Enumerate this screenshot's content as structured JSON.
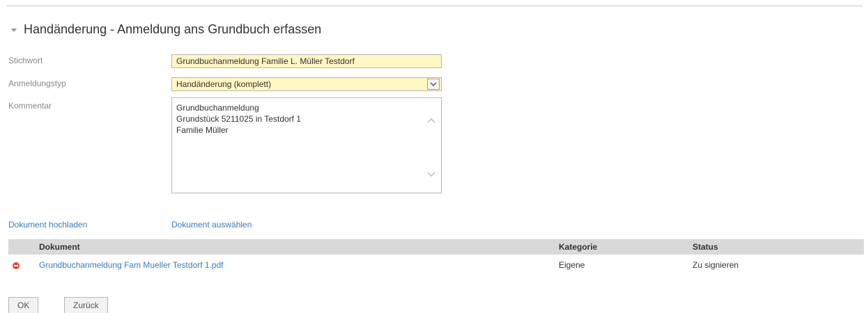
{
  "section": {
    "title": "Handänderung - Anmeldung ans Grundbuch erfassen",
    "toggle_icon": "collapse-triangle-icon"
  },
  "form": {
    "stichwort": {
      "label": "Stichwort",
      "value": "Grundbuchanmeldung Familie L. Müller Testdorf"
    },
    "anmeldungstyp": {
      "label": "Anmeldungstyp",
      "value": "Handänderung (komplett)"
    },
    "kommentar": {
      "label": "Kommentar",
      "value": "Grundbuchanmeldung\nGrundstück 5211025 in Testdorf 1\nFamilie Müller"
    }
  },
  "upload": {
    "hochladen_label": "Dokument hochladen",
    "auswaehlen_label": "Dokument auswählen"
  },
  "documents": {
    "columns": [
      "Dokument",
      "Kategorie",
      "Status"
    ],
    "rows": [
      {
        "name": "Grundbuchanmeldung Fam Mueller Testdorf 1.pdf",
        "kategorie": "Eigene",
        "status": "Zu signieren"
      }
    ]
  },
  "buttons": {
    "ok": "OK",
    "zurueck": "Zurück"
  },
  "colors": {
    "input_background": "#fff7c2",
    "link": "#3b7bb5",
    "table_header": "#d9d9d9",
    "remove_icon": "#e04b3a"
  }
}
